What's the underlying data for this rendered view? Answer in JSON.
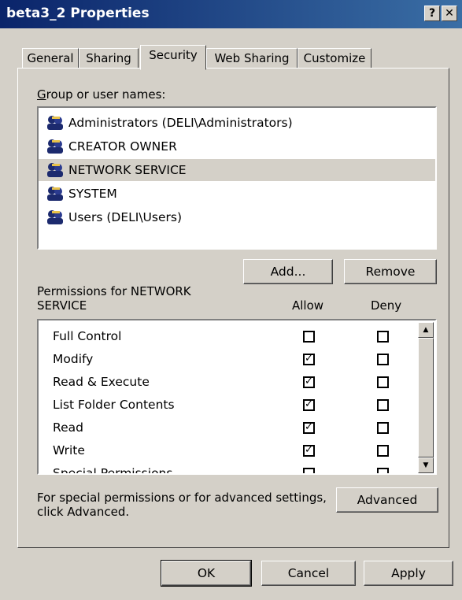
{
  "window": {
    "title": "beta3_2 Properties",
    "help_label": "?",
    "close_label": "✕"
  },
  "tabs": [
    {
      "label": "General"
    },
    {
      "label": "Sharing"
    },
    {
      "label": "Security",
      "active": true
    },
    {
      "label": "Web Sharing"
    },
    {
      "label": "Customize"
    }
  ],
  "group_label": "Group or user names:",
  "users": [
    {
      "name": "Administrators (DELI\\Administrators)",
      "icon": "users-group-icon"
    },
    {
      "name": "CREATOR OWNER",
      "icon": "users-group-icon"
    },
    {
      "name": "NETWORK SERVICE",
      "icon": "users-group-icon",
      "selected": true
    },
    {
      "name": "SYSTEM",
      "icon": "users-group-icon"
    },
    {
      "name": "Users (DELI\\Users)",
      "icon": "users-group-icon"
    }
  ],
  "add_button": "Add...",
  "remove_button": "Remove",
  "permissions_label": "Permissions for NETWORK SERVICE",
  "allow_header": "Allow",
  "deny_header": "Deny",
  "permissions": [
    {
      "name": "Full Control",
      "allow": false,
      "deny": false
    },
    {
      "name": "Modify",
      "allow": true,
      "deny": false
    },
    {
      "name": "Read & Execute",
      "allow": true,
      "deny": false
    },
    {
      "name": "List Folder Contents",
      "allow": true,
      "deny": false
    },
    {
      "name": "Read",
      "allow": true,
      "deny": false
    },
    {
      "name": "Write",
      "allow": true,
      "deny": false
    },
    {
      "name": "Special Permissions",
      "allow": false,
      "deny": false
    }
  ],
  "advanced_text": "For special permissions or for advanced settings, click Advanced.",
  "advanced_button": "Advanced",
  "footer": {
    "ok": "OK",
    "cancel": "Cancel",
    "apply": "Apply"
  },
  "check_mark": "✓",
  "colors": {
    "title_start": "#0a246a",
    "title_end": "#3a6ea5",
    "face": "#d4d0c8"
  }
}
